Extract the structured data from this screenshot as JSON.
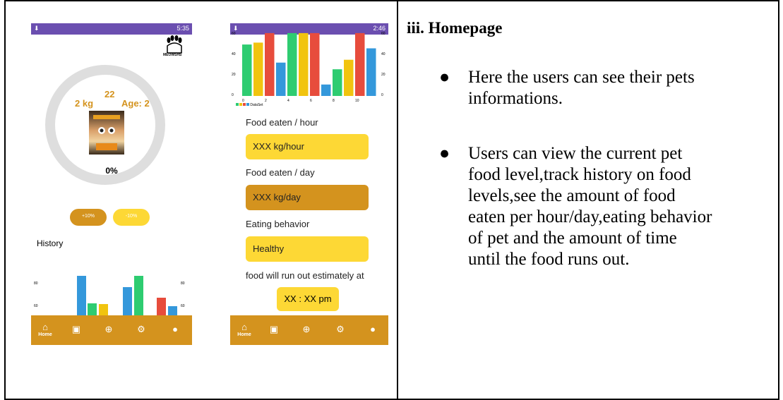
{
  "colors": {
    "accent": "#d4931e",
    "yellow": "#fdd835",
    "status": "#6b4fb0",
    "green": "#2ecc71",
    "blue": "#3498db",
    "red": "#e74c3c",
    "gold": "#f1c40f"
  },
  "phone1": {
    "status_time": "5:35",
    "logo_text": "MEOWSHS",
    "weight": "2 kg",
    "top_num": "22",
    "age": "Age: 2",
    "percent": "0%",
    "plus_btn": "+10%",
    "minus_btn": "-10%",
    "history_label": "History",
    "axis_left": [
      "80",
      "60"
    ],
    "axis_right": [
      "80",
      "60"
    ]
  },
  "phone2": {
    "status_time": "2:46",
    "y_ticks": [
      "60",
      "40",
      "20",
      "0"
    ],
    "x_ticks": [
      "0",
      "2",
      "4",
      "6",
      "8",
      "10"
    ],
    "legend": "DataSet",
    "food_hour_label": "Food eaten / hour",
    "food_hour_value": "XXX kg/hour",
    "food_day_label": "Food eaten / day",
    "food_day_value": "XXX kg/day",
    "behavior_label": "Eating behavior",
    "behavior_value": "Healthy",
    "runout_label": "food will run out estimately at",
    "runout_value": "XX : XX pm"
  },
  "nav": {
    "home_label": "Home"
  },
  "doc": {
    "title": "iii. Homepage",
    "bullet1_lines": [
      "Here the users can see their pets",
      "informations."
    ],
    "bullet2_lines": [
      "Users can view the current pet",
      "food level,track history on food",
      "levels,see the amount of food",
      "eaten per hour/day,eating behavior",
      "of pet and the amount of time",
      "until the food runs out."
    ]
  }
}
